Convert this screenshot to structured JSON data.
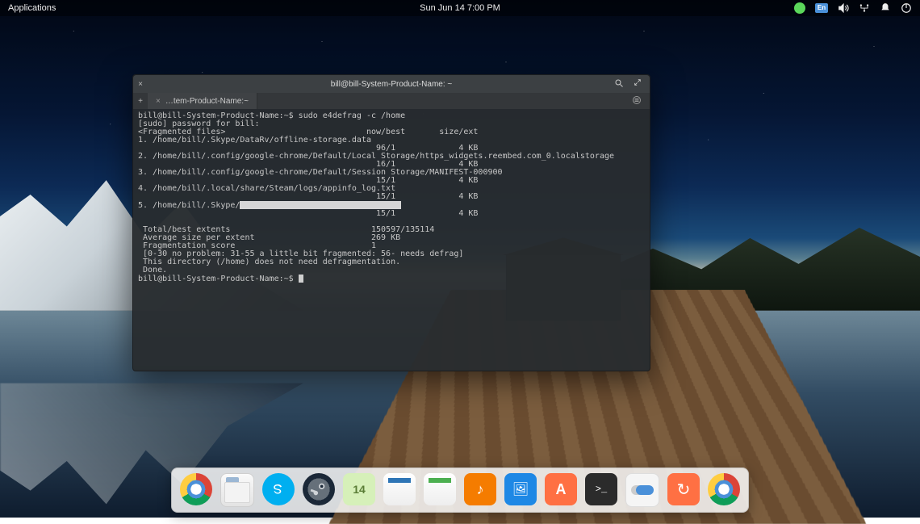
{
  "menubar": {
    "applications_label": "Applications",
    "datetime": "Sun Jun 14   7:00 PM",
    "keyboard_indicator": "En"
  },
  "terminal": {
    "window_title": "bill@bill-System-Product-Name: ~",
    "tab_label": "…tem-Product-Name:~",
    "prompt": "bill@bill-System-Product-Name:~$",
    "command": "sudo e4defrag -c /home",
    "lines": {
      "l01": "bill@bill-System-Product-Name:~$ sudo e4defrag -c /home",
      "l02": "[sudo] password for bill:",
      "l03": "<Fragmented files>                             now/best       size/ext",
      "l04": "1. /home/bill/.Skype/DataRv/offline-storage.data",
      "l05": "                                                 96/1             4 KB",
      "l06": "2. /home/bill/.config/google-chrome/Default/Local Storage/https_widgets.reembed.com_0.localstorage",
      "l07": "                                                 16/1             4 KB",
      "l08": "3. /home/bill/.config/google-chrome/Default/Session Storage/MANIFEST-000900",
      "l09": "                                                 15/1             4 KB",
      "l10": "4. /home/bill/.local/share/Steam/logs/appinfo_log.txt",
      "l11": "                                                 15/1             4 KB",
      "l12a": "5. /home/bill/.Skype/",
      "l13": "                                                 15/1             4 KB",
      "l15": " Total/best extents                             150597/135114",
      "l16": " Average size per extent                        269 KB",
      "l17": " Fragmentation score                            1",
      "l18": " [0-30 no problem: 31-55 a little bit fragmented: 56- needs defrag]",
      "l19": " This directory (/home) does not need defragmentation.",
      "l20": " Done.",
      "l21": "bill@bill-System-Product-Name:~$ "
    }
  },
  "dock": {
    "calendar_day": "14",
    "items": [
      "chrome",
      "files",
      "skype",
      "steam",
      "calendar",
      "writer",
      "calc",
      "music",
      "photos",
      "software",
      "terminal",
      "settings",
      "update",
      "chrome"
    ]
  }
}
